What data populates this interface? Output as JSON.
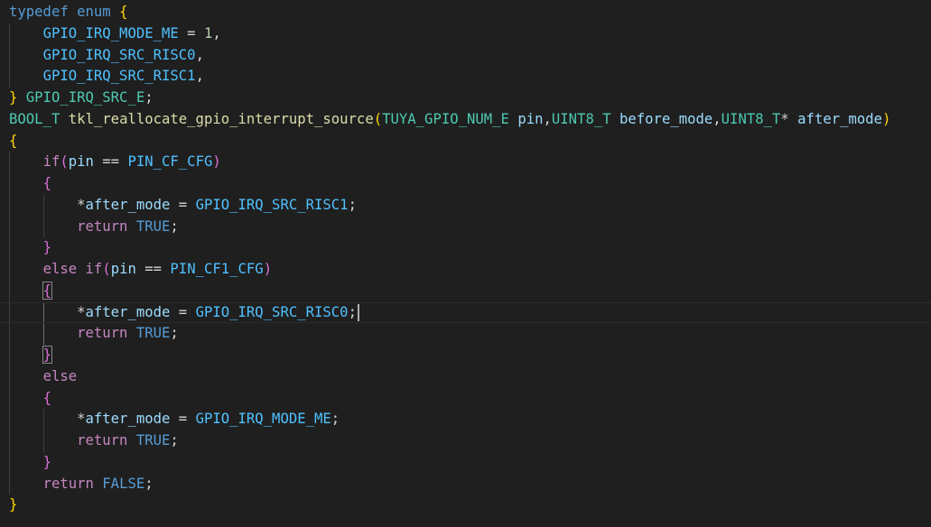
{
  "editor": {
    "lines": [
      {
        "tokens": [
          {
            "t": "typedef",
            "c": "k"
          },
          {
            "t": " "
          },
          {
            "t": "enum",
            "c": "k"
          },
          {
            "t": " "
          },
          {
            "t": "{",
            "c": "b1"
          }
        ]
      },
      {
        "tokens": [
          {
            "t": "    "
          },
          {
            "t": "GPIO_IRQ_MODE_ME",
            "c": "c"
          },
          {
            "t": " = ",
            "c": "p"
          },
          {
            "t": "1",
            "c": "n"
          },
          {
            "t": ",",
            "c": "p"
          }
        ]
      },
      {
        "tokens": [
          {
            "t": "    "
          },
          {
            "t": "GPIO_IRQ_SRC_RISC0",
            "c": "c"
          },
          {
            "t": ",",
            "c": "p"
          }
        ]
      },
      {
        "tokens": [
          {
            "t": "    "
          },
          {
            "t": "GPIO_IRQ_SRC_RISC1",
            "c": "c"
          },
          {
            "t": ",",
            "c": "p"
          }
        ]
      },
      {
        "tokens": [
          {
            "t": "}",
            "c": "b1"
          },
          {
            "t": " "
          },
          {
            "t": "GPIO_IRQ_SRC_E",
            "c": "t"
          },
          {
            "t": ";",
            "c": "p"
          }
        ]
      },
      {
        "tokens": [
          {
            "t": "BOOL_T",
            "c": "t"
          },
          {
            "t": " "
          },
          {
            "t": "tkl_reallocate_gpio_interrupt_source",
            "c": "f"
          },
          {
            "t": "(",
            "c": "b1"
          },
          {
            "t": "TUYA_GPIO_NUM_E",
            "c": "t"
          },
          {
            "t": " "
          },
          {
            "t": "pin",
            "c": "v"
          },
          {
            "t": ",",
            "c": "p"
          },
          {
            "t": "UINT8_T",
            "c": "t"
          },
          {
            "t": " "
          },
          {
            "t": "before_mode",
            "c": "v"
          },
          {
            "t": ",",
            "c": "p"
          },
          {
            "t": "UINT8_T",
            "c": "t"
          },
          {
            "t": "* ",
            "c": "p"
          },
          {
            "t": "after_mode",
            "c": "v"
          },
          {
            "t": ")",
            "c": "b1"
          }
        ]
      },
      {
        "tokens": [
          {
            "t": "{",
            "c": "b1"
          }
        ]
      },
      {
        "tokens": [
          {
            "t": "    "
          },
          {
            "t": "if",
            "c": "kc"
          },
          {
            "t": "(",
            "c": "b2"
          },
          {
            "t": "pin",
            "c": "v"
          },
          {
            "t": " == ",
            "c": "p"
          },
          {
            "t": "PIN_CF_CFG",
            "c": "c"
          },
          {
            "t": ")",
            "c": "b2"
          }
        ]
      },
      {
        "tokens": [
          {
            "t": "    "
          },
          {
            "t": "{",
            "c": "b2"
          }
        ]
      },
      {
        "tokens": [
          {
            "t": "        "
          },
          {
            "t": "*",
            "c": "p"
          },
          {
            "t": "after_mode",
            "c": "v"
          },
          {
            "t": " = ",
            "c": "p"
          },
          {
            "t": "GPIO_IRQ_SRC_RISC1",
            "c": "c"
          },
          {
            "t": ";",
            "c": "p"
          }
        ]
      },
      {
        "tokens": [
          {
            "t": "        "
          },
          {
            "t": "return",
            "c": "kc"
          },
          {
            "t": " "
          },
          {
            "t": "TRUE",
            "c": "k"
          },
          {
            "t": ";",
            "c": "p"
          }
        ]
      },
      {
        "tokens": [
          {
            "t": "    "
          },
          {
            "t": "}",
            "c": "b2"
          }
        ]
      },
      {
        "tokens": [
          {
            "t": "    "
          },
          {
            "t": "else",
            "c": "kc"
          },
          {
            "t": " "
          },
          {
            "t": "if",
            "c": "kc"
          },
          {
            "t": "(",
            "c": "b2"
          },
          {
            "t": "pin",
            "c": "v"
          },
          {
            "t": " == ",
            "c": "p"
          },
          {
            "t": "PIN_CF1_CFG",
            "c": "c"
          },
          {
            "t": ")",
            "c": "b2"
          }
        ]
      },
      {
        "tokens": [
          {
            "t": "    "
          },
          {
            "t": "{",
            "c": "b2 bm"
          }
        ]
      },
      {
        "tokens": [
          {
            "t": "        "
          },
          {
            "t": "*",
            "c": "p"
          },
          {
            "t": "after_mode",
            "c": "v"
          },
          {
            "t": " = ",
            "c": "p"
          },
          {
            "t": "GPIO_IRQ_SRC_RISC0",
            "c": "c"
          },
          {
            "t": ";",
            "c": "p"
          }
        ],
        "current": true
      },
      {
        "tokens": [
          {
            "t": "        "
          },
          {
            "t": "return",
            "c": "kc"
          },
          {
            "t": " "
          },
          {
            "t": "TRUE",
            "c": "k"
          },
          {
            "t": ";",
            "c": "p"
          }
        ]
      },
      {
        "tokens": [
          {
            "t": "    "
          },
          {
            "t": "}",
            "c": "b2 bm"
          }
        ]
      },
      {
        "tokens": [
          {
            "t": "    "
          },
          {
            "t": "else",
            "c": "kc"
          }
        ]
      },
      {
        "tokens": [
          {
            "t": "    "
          },
          {
            "t": "{",
            "c": "b2"
          }
        ]
      },
      {
        "tokens": [
          {
            "t": "        "
          },
          {
            "t": "*",
            "c": "p"
          },
          {
            "t": "after_mode",
            "c": "v"
          },
          {
            "t": " = ",
            "c": "p"
          },
          {
            "t": "GPIO_IRQ_MODE_ME",
            "c": "c"
          },
          {
            "t": ";",
            "c": "p"
          }
        ]
      },
      {
        "tokens": [
          {
            "t": "        "
          },
          {
            "t": "return",
            "c": "kc"
          },
          {
            "t": " "
          },
          {
            "t": "TRUE",
            "c": "k"
          },
          {
            "t": ";",
            "c": "p"
          }
        ]
      },
      {
        "tokens": [
          {
            "t": "    "
          },
          {
            "t": "}",
            "c": "b2"
          }
        ]
      },
      {
        "tokens": [
          {
            "t": "    "
          },
          {
            "t": "return",
            "c": "kc"
          },
          {
            "t": " "
          },
          {
            "t": "FALSE",
            "c": "k"
          },
          {
            "t": ";",
            "c": "p"
          }
        ]
      },
      {
        "tokens": [
          {
            "t": "}",
            "c": "b1"
          }
        ]
      }
    ],
    "cursor": {
      "line": 14
    }
  },
  "colors": {
    "background": "#1f1f1f",
    "keyword": "#569cd6",
    "control_keyword": "#c586c0",
    "type": "#4ec9b0",
    "function": "#dcdcaa",
    "variable": "#9cdcfe",
    "constant": "#4fc1ff",
    "number": "#b5cea8",
    "bracket_level_1": "#ffd700",
    "bracket_level_2": "#da70d6"
  }
}
